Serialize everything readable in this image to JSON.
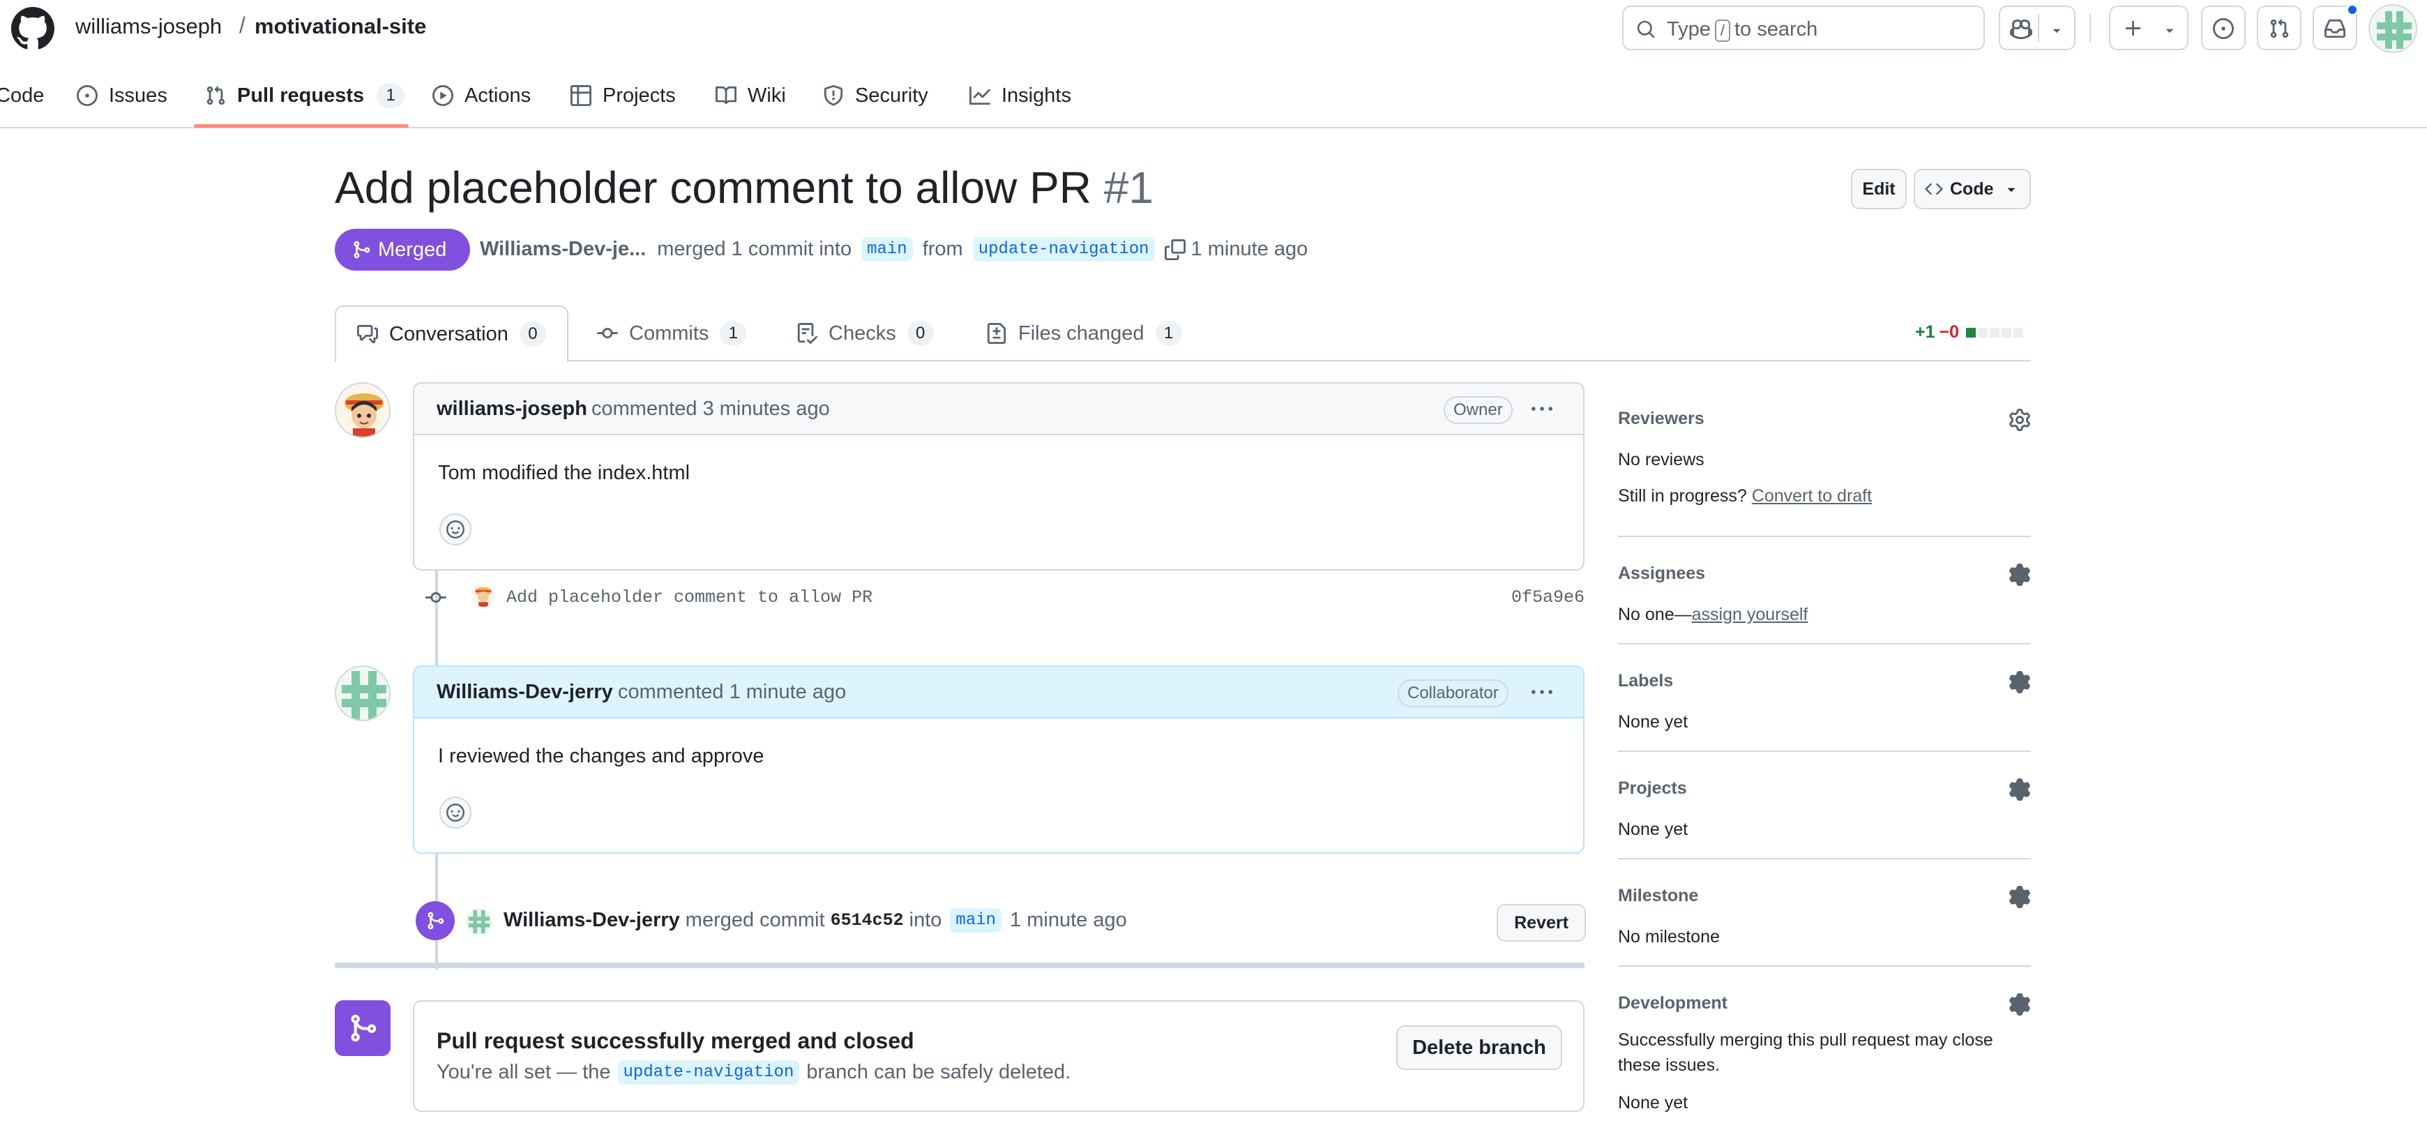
{
  "header": {
    "owner": "williams-joseph",
    "separator": "/",
    "repo": "motivational-site",
    "search_prefix": "Type",
    "search_key": "/",
    "search_suffix": "to search"
  },
  "repo_nav": [
    {
      "label": "Code",
      "icon": "code-icon"
    },
    {
      "label": "Issues",
      "icon": "issue-opened-icon"
    },
    {
      "label": "Pull requests",
      "icon": "git-pull-request-icon",
      "counter": "1",
      "selected": true
    },
    {
      "label": "Actions",
      "icon": "play-icon"
    },
    {
      "label": "Projects",
      "icon": "table-icon"
    },
    {
      "label": "Wiki",
      "icon": "book-icon"
    },
    {
      "label": "Security",
      "icon": "shield-icon"
    },
    {
      "label": "Insights",
      "icon": "graph-icon"
    }
  ],
  "pr": {
    "title": "Add placeholder comment to allow PR",
    "number": "#1",
    "edit_label": "Edit",
    "code_label": "Code",
    "state": "Merged",
    "author": "Williams-Dev-je...",
    "merged_text": "merged 1 commit into",
    "base_branch": "main",
    "from_text": "from",
    "head_branch": "update-navigation",
    "time": "1 minute ago"
  },
  "tabs": [
    {
      "label": "Conversation",
      "count": "0",
      "active": true,
      "icon": "comment-discussion-icon"
    },
    {
      "label": "Commits",
      "count": "1",
      "icon": "git-commit-icon"
    },
    {
      "label": "Checks",
      "count": "0",
      "icon": "checklist-icon"
    },
    {
      "label": "Files changed",
      "count": "1",
      "icon": "file-diff-icon"
    }
  ],
  "diffstat": {
    "additions": "+1",
    "deletions": "−0",
    "green_blocks": 1,
    "total_blocks": 5
  },
  "comments": [
    {
      "author": "williams-joseph",
      "time_text": "commented 3 minutes ago",
      "role": "Owner",
      "body": "Tom modified the index.html"
    },
    {
      "author": "Williams-Dev-jerry",
      "time_text": "commented 1 minute ago",
      "role": "Collaborator",
      "body": "I reviewed the changes and approve"
    }
  ],
  "commit": {
    "message": "Add placeholder comment to allow PR",
    "sha": "0f5a9e6"
  },
  "merge_event": {
    "actor": "Williams-Dev-jerry",
    "text": "merged commit",
    "sha": "6514c52",
    "into_text": "into",
    "branch": "main",
    "time": "1 minute ago",
    "revert_label": "Revert"
  },
  "merged_box": {
    "title": "Pull request successfully merged and closed",
    "desc_prefix": "You're all set — the",
    "branch": "update-navigation",
    "desc_suffix": "branch can be safely deleted.",
    "button": "Delete branch"
  },
  "sidebar": {
    "reviewers": {
      "title": "Reviewers",
      "text": "No reviews",
      "progress_text": "Still in progress?",
      "progress_link": "Convert to draft"
    },
    "assignees": {
      "title": "Assignees",
      "text": "No one—",
      "link": "assign yourself"
    },
    "labels": {
      "title": "Labels",
      "text": "None yet"
    },
    "projects": {
      "title": "Projects",
      "text": "None yet"
    },
    "milestone": {
      "title": "Milestone",
      "text": "No milestone"
    },
    "development": {
      "title": "Development",
      "text": "Successfully merging this pull request may close these issues.",
      "text2": "None yet"
    }
  },
  "colors": {
    "merged_purple": "#8250df",
    "accent_blue": "#0969da",
    "nav_underline": "#fd8c73",
    "diff_green": "#1a7f37",
    "diff_red": "#d1242f"
  }
}
